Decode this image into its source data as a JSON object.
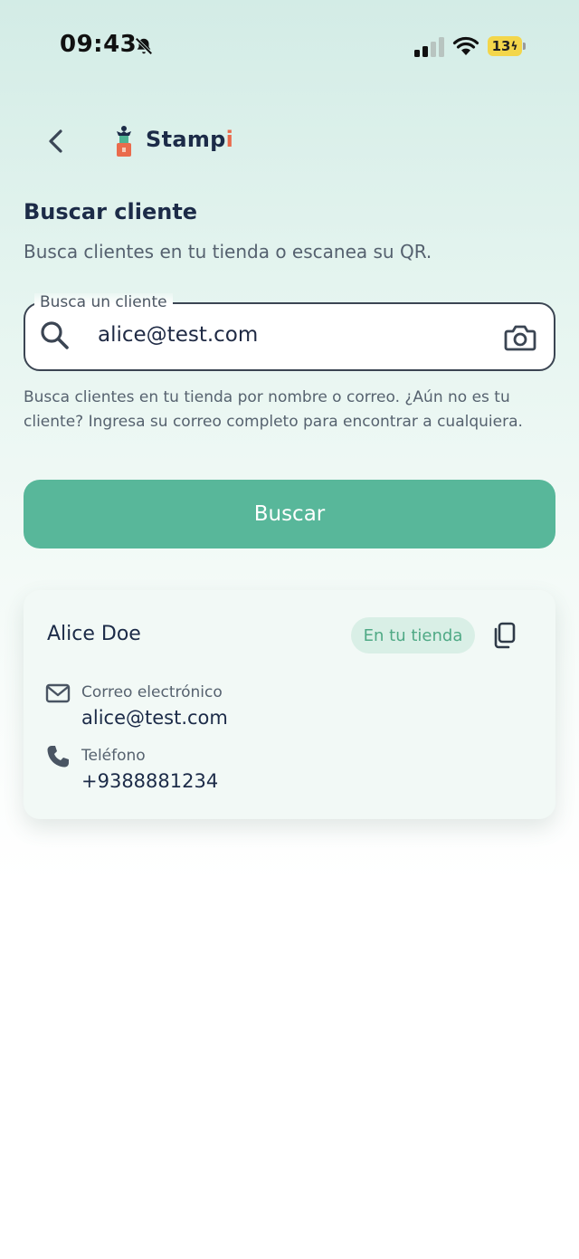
{
  "status_bar": {
    "time": "09:43",
    "battery": "13"
  },
  "header": {
    "logo_text_main": "Stamp",
    "logo_text_accent": "i"
  },
  "page": {
    "title": "Buscar cliente",
    "subtitle": "Busca clientes en tu tienda o escanea su QR."
  },
  "search": {
    "legend": "Busca un cliente",
    "value": "alice@test.com",
    "helper": "Busca clientes en tu tienda por nombre o correo. ¿Aún no es tu cliente? Ingresa su correo completo para encontrar a cualquiera."
  },
  "actions": {
    "search_button": "Buscar"
  },
  "result": {
    "name": "Alice Doe",
    "badge": "En tu tienda",
    "email_label": "Correo electrónico",
    "email": "alice@test.com",
    "phone_label": "Teléfono",
    "phone": "+9388881234"
  },
  "colors": {
    "primary": "#58b79a",
    "badge_bg": "#d9efe6",
    "badge_text": "#4fa985",
    "heading": "#1c2b48",
    "logo_accent": "#ea6b4c"
  },
  "icons": [
    "bell-slash-icon",
    "signal-icon",
    "wifi-icon",
    "battery-icon",
    "back-chevron-icon",
    "stampi-logo-icon",
    "search-icon",
    "camera-icon",
    "copy-icon",
    "mail-icon",
    "phone-icon"
  ]
}
